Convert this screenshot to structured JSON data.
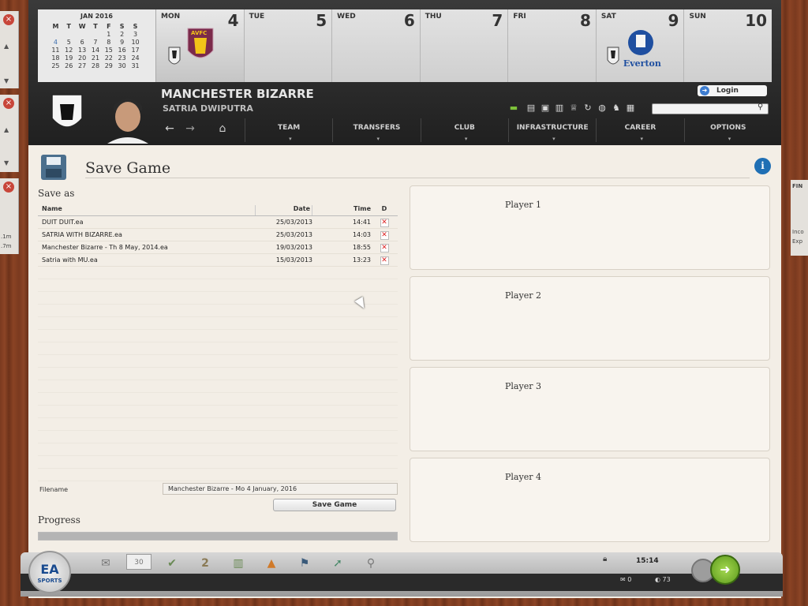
{
  "calendar": {
    "month_title": "JAN 2016",
    "weekday_headers": [
      "M",
      "T",
      "W",
      "T",
      "F",
      "S",
      "S"
    ],
    "weeks": [
      [
        "",
        "",
        "",
        "",
        "1",
        "2",
        "3"
      ],
      [
        "4",
        "5",
        "6",
        "7",
        "8",
        "9",
        "10"
      ],
      [
        "11",
        "12",
        "13",
        "14",
        "15",
        "16",
        "17"
      ],
      [
        "18",
        "19",
        "20",
        "21",
        "22",
        "23",
        "24"
      ],
      [
        "25",
        "26",
        "27",
        "28",
        "29",
        "30",
        "31"
      ]
    ],
    "days": [
      {
        "name": "MON",
        "date": "4"
      },
      {
        "name": "TUE",
        "date": "5"
      },
      {
        "name": "WED",
        "date": "6"
      },
      {
        "name": "THU",
        "date": "7"
      },
      {
        "name": "FRI",
        "date": "8"
      },
      {
        "name": "SAT",
        "date": "9"
      },
      {
        "name": "SUN",
        "date": "10"
      }
    ],
    "mon_crest_text": "AVFC",
    "sat_crest_text": "Everton"
  },
  "header": {
    "club_name": "MANCHESTER BIZARRE",
    "manager_name": "SATRIA DWIPUTRA",
    "login_label": "Login",
    "search_placeholder": "",
    "nav_back": "←",
    "nav_forward": "→",
    "nav_home": "⌂",
    "menu": [
      "TEAM",
      "TRANSFERS",
      "CLUB",
      "INFRASTRUCTURE",
      "CAREER",
      "OPTIONS"
    ]
  },
  "page": {
    "title": "Save Game",
    "info_label": "i"
  },
  "save_as": {
    "heading": "Save as",
    "columns": {
      "name": "Name",
      "date": "Date",
      "time": "Time",
      "del": "D"
    },
    "rows": [
      {
        "name": "DUIT DUIT.ea",
        "date": "25/03/2013",
        "time": "14:41"
      },
      {
        "name": "SATRIA WITH BIZARRE.ea",
        "date": "25/03/2013",
        "time": "14:03"
      },
      {
        "name": "Manchester Bizarre - Th 8 May, 2014.ea",
        "date": "19/03/2013",
        "time": "18:55"
      },
      {
        "name": "Satria with MU.ea",
        "date": "15/03/2013",
        "time": "13:23"
      }
    ],
    "filename_label": "Filename",
    "filename_value": "Manchester Bizarre - Mo 4 January, 2016",
    "save_button": "Save Game",
    "progress_heading": "Progress",
    "progress_value": 1.0
  },
  "players": [
    "Player 1",
    "Player 2",
    "Player 3",
    "Player 4"
  ],
  "bottom": {
    "clock": "15:14",
    "mail_count": "0",
    "fans_count": "73",
    "ea_top": "EA",
    "ea_bottom": "SPORTS",
    "calendar_icon_num": "30",
    "badge_num": "2"
  },
  "sidewin": {
    "right_title": "FIN",
    "right_lines": [
      "Inco",
      "Exp"
    ],
    "left_lines": [
      ".1m",
      ".7m"
    ]
  }
}
